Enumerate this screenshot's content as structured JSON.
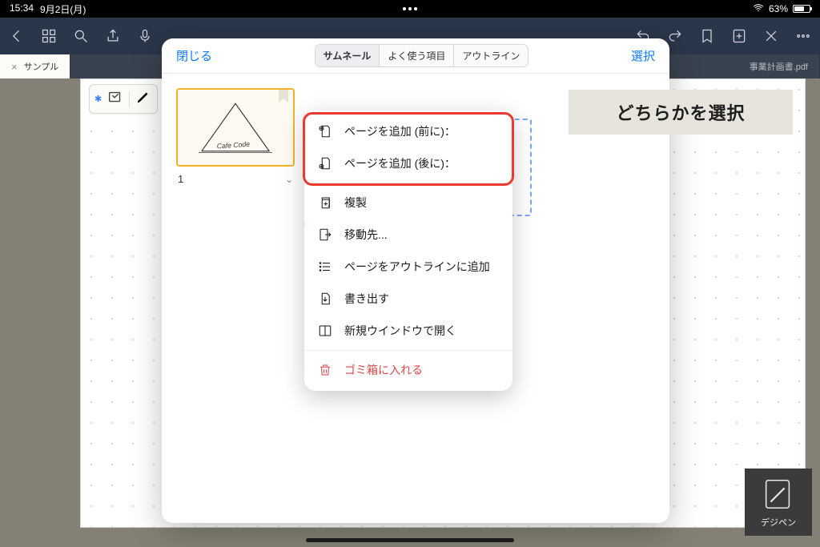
{
  "statusbar": {
    "time": "15:34",
    "date": "9月2日(月)",
    "battery_pct": "63%"
  },
  "tabs": {
    "left": "サンプル",
    "right": "事業計画書.pdf"
  },
  "panel": {
    "close": "閉じる",
    "select": "選択",
    "segments": {
      "thumbnail": "サムネール",
      "favorites": "よく使う項目",
      "outline": "アウトライン"
    },
    "page_number": "1",
    "thumb_label": "Cafe Code"
  },
  "menu": {
    "add_before": "ページを追加 (前に)：",
    "add_after": "ページを追加 (後に)：",
    "duplicate": "複製",
    "move_to": "移動先...",
    "add_outline": "ページをアウトラインに追加",
    "export": "書き出す",
    "new_window": "新規ウインドウで開く",
    "trash": "ゴミ箱に入れる"
  },
  "annotation": "どちらかを選択",
  "logo": "デジペン"
}
